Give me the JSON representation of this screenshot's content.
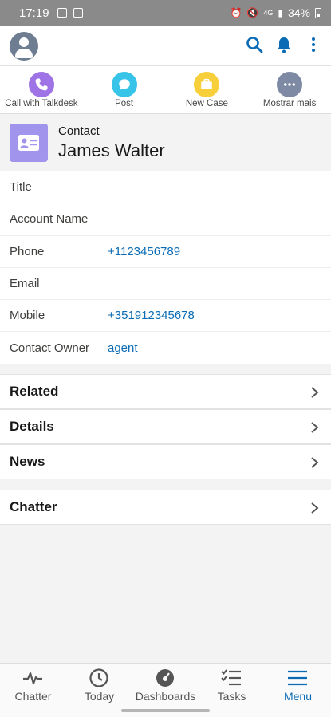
{
  "status_bar": {
    "time": "17:19",
    "network": "4G",
    "battery": "34%"
  },
  "header": {
    "avatar_icon": "user-avatar-icon",
    "icons": [
      "search-icon",
      "bell-icon",
      "more-vertical-icon"
    ],
    "accent": "#0b6cb5"
  },
  "quick_actions": [
    {
      "label": "Call with Talkdesk",
      "icon": "phone-icon",
      "color": "#9d73e6"
    },
    {
      "label": "Post",
      "icon": "chat-bubble-icon",
      "color": "#38c3e8"
    },
    {
      "label": "New Case",
      "icon": "briefcase-icon",
      "color": "#f6cf3a"
    },
    {
      "label": "Mostrar mais",
      "icon": "ellipsis-icon",
      "color": "#7e8aa4"
    }
  ],
  "record": {
    "type": "Contact",
    "name": "James Walter",
    "icon": "contact-card-icon",
    "icon_color": "#a094ed"
  },
  "fields": [
    {
      "label": "Title",
      "value": ""
    },
    {
      "label": "Account Name",
      "value": ""
    },
    {
      "label": "Phone",
      "value": "+1123456789"
    },
    {
      "label": "Email",
      "value": ""
    },
    {
      "label": "Mobile",
      "value": "+351912345678"
    },
    {
      "label": "Contact Owner",
      "value": "agent"
    }
  ],
  "sections": [
    {
      "label": "Related"
    },
    {
      "label": "Details"
    },
    {
      "label": "News"
    },
    {
      "label": "Chatter"
    }
  ],
  "bottom_nav": [
    {
      "label": "Chatter",
      "icon": "activity-pulse-icon",
      "active": false
    },
    {
      "label": "Today",
      "icon": "clock-icon",
      "active": false
    },
    {
      "label": "Dashboards",
      "icon": "gauge-icon",
      "active": false
    },
    {
      "label": "Tasks",
      "icon": "task-list-icon",
      "active": false
    },
    {
      "label": "Menu",
      "icon": "hamburger-menu-icon",
      "active": true
    }
  ]
}
